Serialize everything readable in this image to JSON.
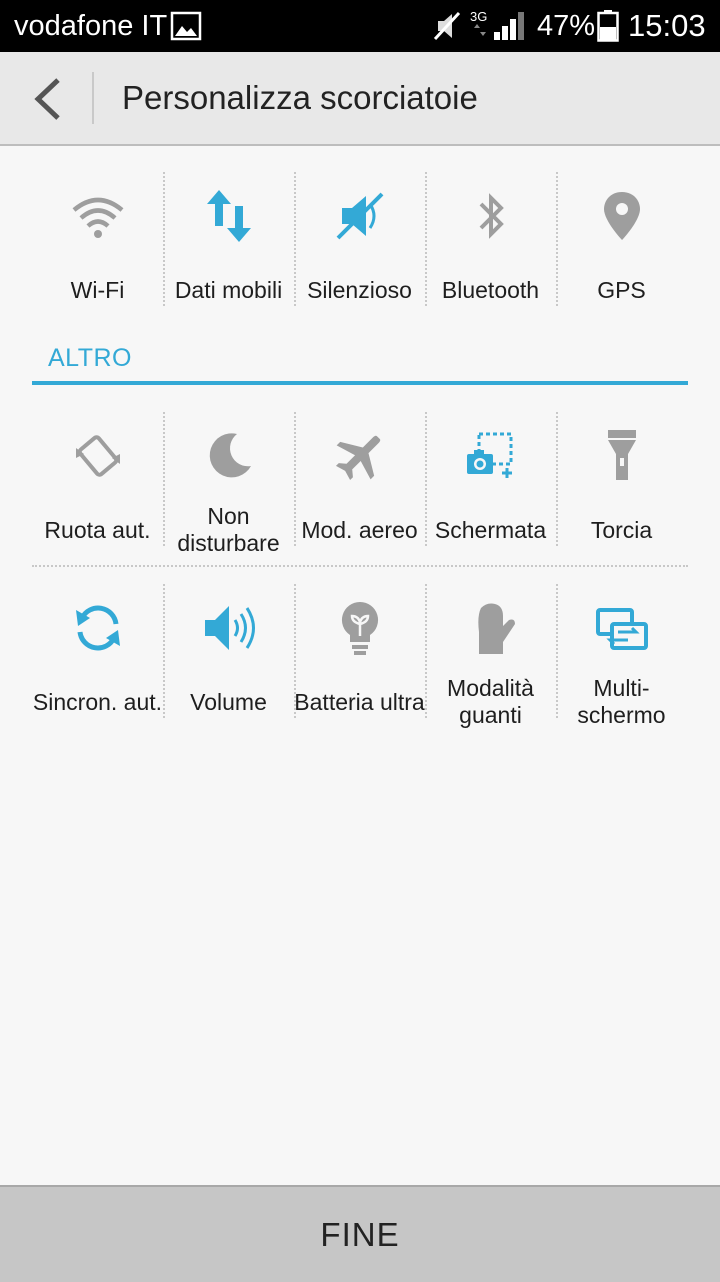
{
  "status_bar": {
    "carrier": "vodafone IT",
    "network": "3G",
    "battery": "47%",
    "time": "15:03"
  },
  "header": {
    "title": "Personalizza scorciatoie"
  },
  "top_tiles": [
    {
      "label": "Wi-Fi",
      "icon": "wifi-icon"
    },
    {
      "label": "Dati mobili",
      "icon": "mobile-data-icon"
    },
    {
      "label": "Silenzioso",
      "icon": "silent-icon"
    },
    {
      "label": "Bluetooth",
      "icon": "bluetooth-icon"
    },
    {
      "label": "GPS",
      "icon": "gps-icon"
    }
  ],
  "section": {
    "title": "ALTRO"
  },
  "other_tiles": [
    {
      "label": "Ruota aut.",
      "icon": "auto-rotate-icon"
    },
    {
      "label": "Non disturbare",
      "icon": "moon-icon"
    },
    {
      "label": "Mod. aereo",
      "icon": "airplane-icon"
    },
    {
      "label": "Schermata",
      "icon": "screenshot-icon"
    },
    {
      "label": "Torcia",
      "icon": "flashlight-icon"
    },
    {
      "label": "Sincron. aut.",
      "icon": "sync-icon"
    },
    {
      "label": "Volume",
      "icon": "volume-icon"
    },
    {
      "label": "Batteria ultra",
      "icon": "lightbulb-icon"
    },
    {
      "label": "Modalità guanti",
      "icon": "glove-icon"
    },
    {
      "label": "Multi-schermo",
      "icon": "multiscreen-icon"
    }
  ],
  "footer": {
    "done_label": "FINE"
  },
  "colors": {
    "accent": "#33a9d6",
    "inactive_icon": "#9e9e9e",
    "status_bar": "#000000",
    "title_bar": "#e8e8e8",
    "footer": "#c6c6c6"
  }
}
